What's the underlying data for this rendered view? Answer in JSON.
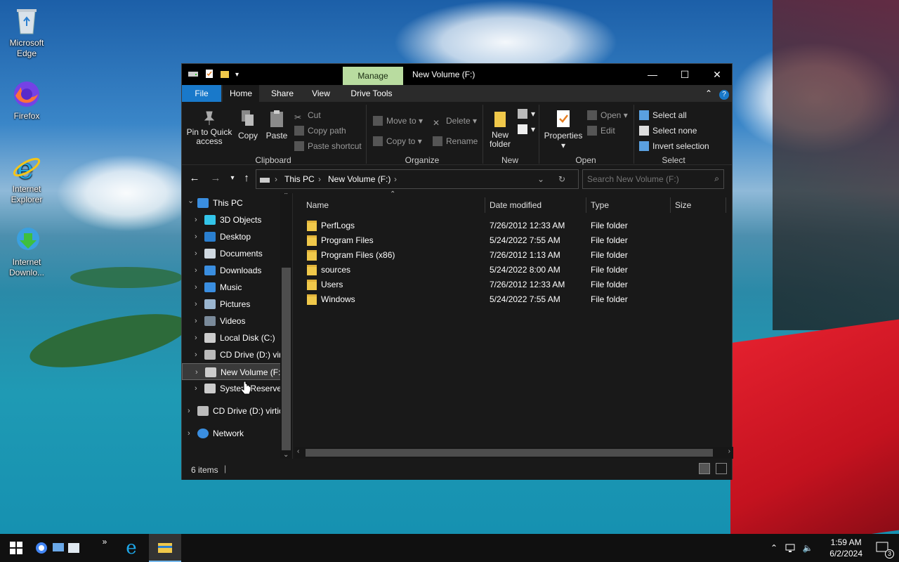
{
  "desktop": {
    "icons": [
      {
        "label": "Microsoft Edge",
        "icon": "recycle-bin-icon"
      },
      {
        "label": "Firefox",
        "icon": "firefox-icon"
      },
      {
        "label": "Internet Explorer",
        "icon": "internet-explorer-icon"
      },
      {
        "label": "Internet Downlo...",
        "icon": "internet-download-manager-icon"
      }
    ]
  },
  "window": {
    "title": "New Volume (F:)",
    "manage_tab": "Manage",
    "tabs": [
      "File",
      "Home",
      "Share",
      "View",
      "Drive Tools"
    ],
    "ribbon": {
      "clipboard": {
        "pin": "Pin to Quick access",
        "copy": "Copy",
        "paste": "Paste",
        "cut": "Cut",
        "copy_path": "Copy path",
        "paste_shortcut": "Paste shortcut",
        "group": "Clipboard"
      },
      "organize": {
        "move_to": "Move to",
        "copy_to": "Copy to",
        "delete": "Delete",
        "rename": "Rename",
        "group": "Organize"
      },
      "new": {
        "new_folder": "New folder",
        "group": "New"
      },
      "open": {
        "properties": "Properties",
        "open": "Open",
        "edit": "Edit",
        "group": "Open"
      },
      "select": {
        "select_all": "Select all",
        "select_none": "Select none",
        "invert": "Invert selection",
        "group": "Select"
      }
    },
    "address": {
      "crumbs": [
        "This PC",
        "New Volume (F:)"
      ],
      "search_placeholder": "Search New Volume (F:)"
    },
    "nav": [
      {
        "label": "This PC",
        "icon": "this-pc-icon",
        "expanded": true
      },
      {
        "label": "3D Objects",
        "icon": "3d-objects-icon"
      },
      {
        "label": "Desktop",
        "icon": "desktop-icon"
      },
      {
        "label": "Documents",
        "icon": "documents-icon"
      },
      {
        "label": "Downloads",
        "icon": "downloads-icon"
      },
      {
        "label": "Music",
        "icon": "music-icon"
      },
      {
        "label": "Pictures",
        "icon": "pictures-icon"
      },
      {
        "label": "Videos",
        "icon": "videos-icon"
      },
      {
        "label": "Local Disk (C:)",
        "icon": "drive-icon"
      },
      {
        "label": "CD Drive (D:) virt",
        "icon": "cd-drive-icon"
      },
      {
        "label": "New Volume (F:)",
        "icon": "drive-icon",
        "selected": true
      },
      {
        "label": "System Reserved",
        "icon": "drive-icon"
      },
      {
        "label": "CD Drive (D:) virtio",
        "icon": "cd-drive-icon"
      },
      {
        "label": "Network",
        "icon": "network-icon"
      }
    ],
    "columns": [
      "Name",
      "Date modified",
      "Type",
      "Size"
    ],
    "files": [
      {
        "name": "PerfLogs",
        "date": "7/26/2012 12:33 AM",
        "type": "File folder",
        "size": ""
      },
      {
        "name": "Program Files",
        "date": "5/24/2022 7:55 AM",
        "type": "File folder",
        "size": ""
      },
      {
        "name": "Program Files (x86)",
        "date": "7/26/2012 1:13 AM",
        "type": "File folder",
        "size": ""
      },
      {
        "name": "sources",
        "date": "5/24/2022 8:00 AM",
        "type": "File folder",
        "size": ""
      },
      {
        "name": "Users",
        "date": "7/26/2012 12:33 AM",
        "type": "File folder",
        "size": ""
      },
      {
        "name": "Windows",
        "date": "5/24/2022 7:55 AM",
        "type": "File folder",
        "size": ""
      }
    ],
    "status": "6 items"
  },
  "taskbar": {
    "time": "1:59 AM",
    "date": "6/2/2024",
    "notification_count": "3"
  },
  "colors": {
    "accent": "#1979ca",
    "manage_tab": "#b9dca0",
    "folder": "#f0c84a"
  }
}
